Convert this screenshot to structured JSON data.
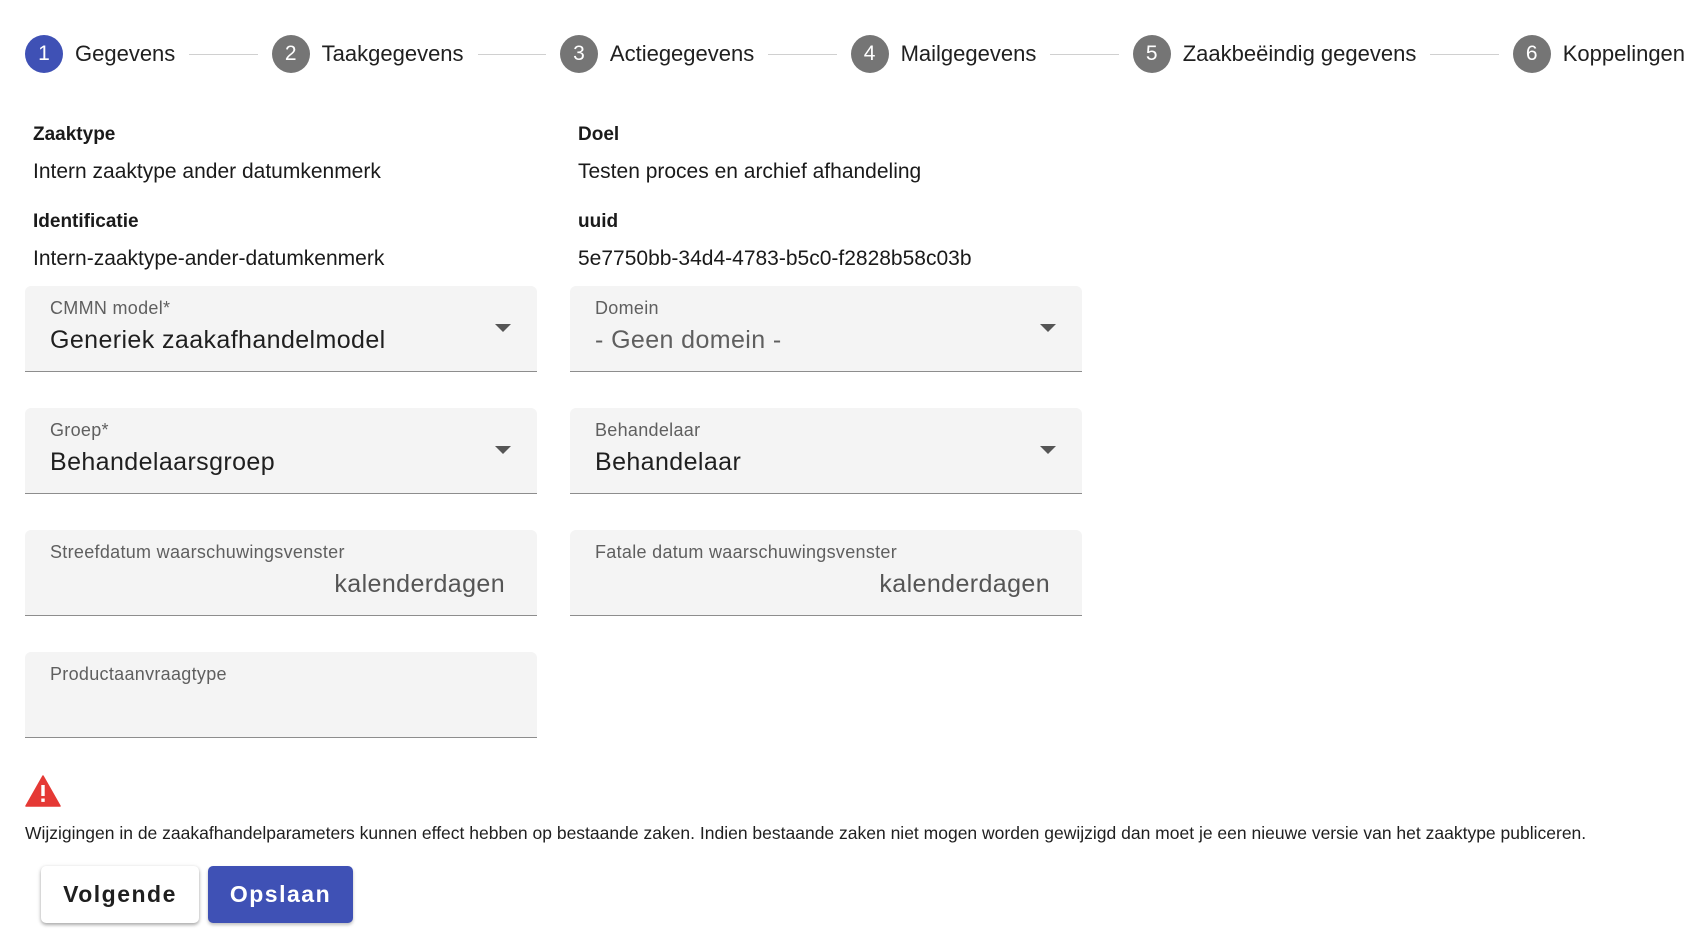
{
  "stepper": {
    "steps": [
      {
        "number": "1",
        "label": "Gegevens",
        "active": true
      },
      {
        "number": "2",
        "label": "Taakgegevens",
        "active": false
      },
      {
        "number": "3",
        "label": "Actiegegevens",
        "active": false
      },
      {
        "number": "4",
        "label": "Mailgegevens",
        "active": false
      },
      {
        "number": "5",
        "label": "Zaakbeëindig gegevens",
        "active": false
      },
      {
        "number": "6",
        "label": "Koppelingen",
        "active": false
      }
    ]
  },
  "info": {
    "zaaktype": {
      "label": "Zaaktype",
      "value": "Intern zaaktype ander datumkenmerk"
    },
    "doel": {
      "label": "Doel",
      "value": "Testen proces en archief afhandeling"
    },
    "identificatie": {
      "label": "Identificatie",
      "value": "Intern-zaaktype-ander-datumkenmerk"
    },
    "uuid": {
      "label": "uuid",
      "value": "5e7750bb-34d4-4783-b5c0-f2828b58c03b"
    }
  },
  "form": {
    "cmmn_model": {
      "label": "CMMN model*",
      "value": "Generiek zaakafhandelmodel"
    },
    "domein": {
      "label": "Domein",
      "value": "- Geen domein -"
    },
    "groep": {
      "label": "Groep*",
      "value": "Behandelaarsgroep"
    },
    "behandelaar": {
      "label": "Behandelaar",
      "value": "Behandelaar"
    },
    "streefdatum": {
      "label": "Streefdatum waarschuwingsvenster",
      "value": "",
      "suffix": "kalenderdagen"
    },
    "fatale_datum": {
      "label": "Fatale datum waarschuwingsvenster",
      "value": "",
      "suffix": "kalenderdagen"
    },
    "productaanvraagtype": {
      "label": "Productaanvraagtype",
      "value": ""
    }
  },
  "warning": {
    "icon": "warning-icon",
    "color": "#e53935",
    "text": "Wijzigingen in de zaakafhandelparameters kunnen effect hebben op bestaande zaken. Indien bestaande zaken niet mogen worden gewijzigd dan moet je een nieuwe versie van het zaaktype publiceren."
  },
  "actions": {
    "next_label": "Volgende",
    "save_label": "Opslaan"
  },
  "colors": {
    "accent": "#3f51b5",
    "inactive_step": "#757575",
    "field_background": "#f4f4f4"
  }
}
